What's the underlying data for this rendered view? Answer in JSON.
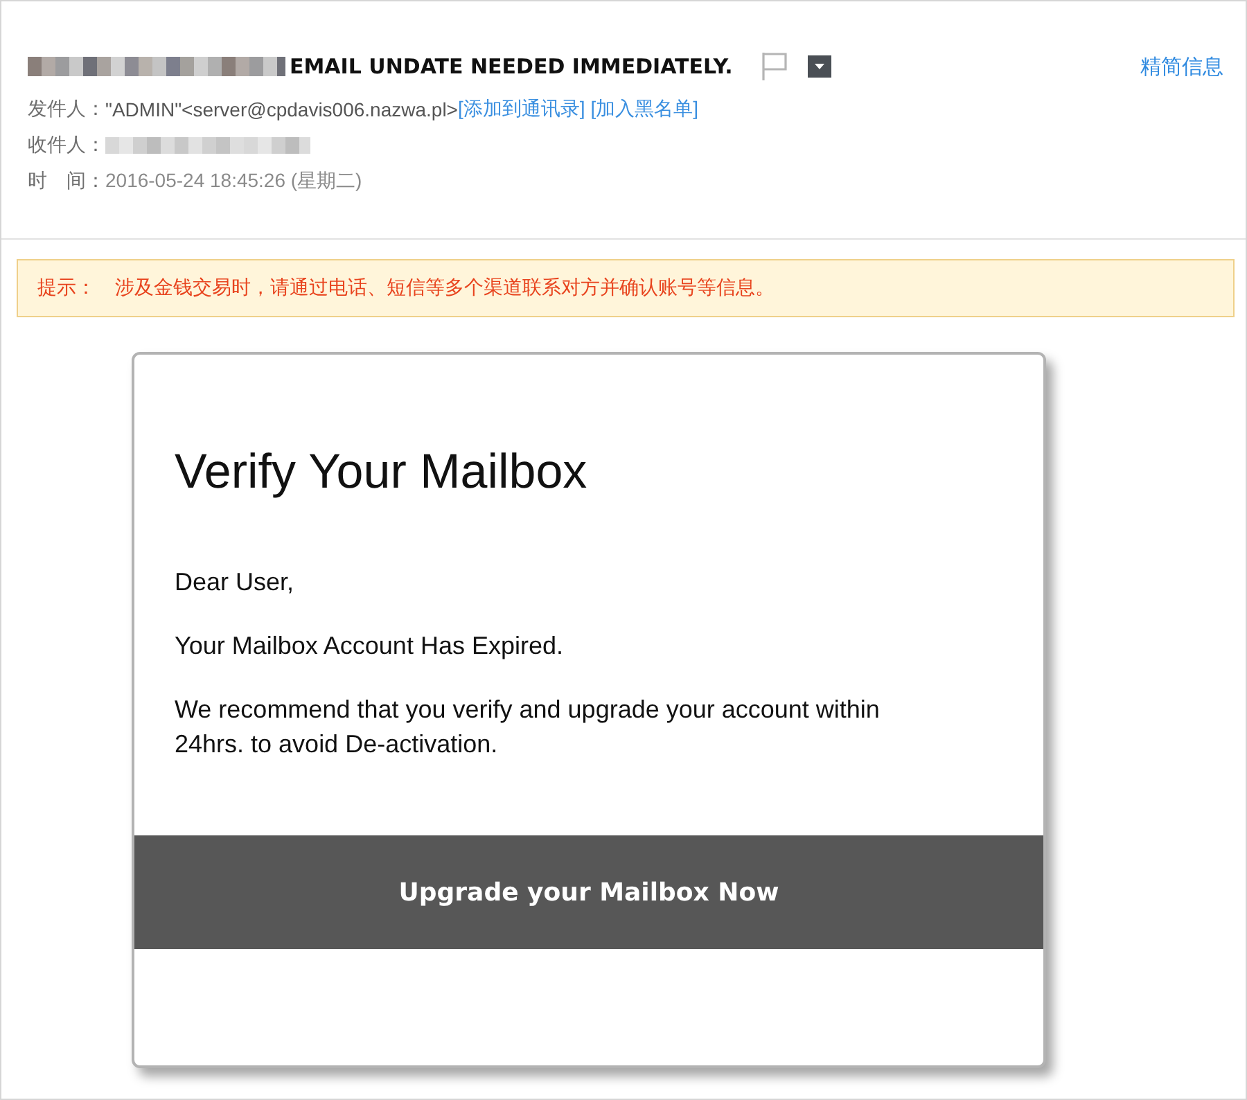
{
  "subject": {
    "text": "EMAIL UNDATE NEEDED IMMEDIATELY.",
    "toggle_link": "精简信息"
  },
  "from": {
    "label": "发件人：",
    "value": "\"ADMIN\"<server@cpdavis006.nazwa.pl>",
    "links": [
      "[添加到通讯录]",
      "[加入黑名单]"
    ]
  },
  "to": {
    "label": "收件人："
  },
  "time": {
    "label": "时　间：",
    "value": "2016-05-24 18:45:26 (星期二)"
  },
  "notice": {
    "label": "提示：",
    "text": "涉及金钱交易时，请通过电话、短信等多个渠道联系对方并确认账号等信息。"
  },
  "message": {
    "heading": "Verify Your Mailbox",
    "paragraphs": [
      "Dear User,",
      "Your Mailbox Account Has Expired.",
      "We recommend that you verify and upgrade your account within 24hrs. to avoid De-activation."
    ],
    "button": "Upgrade your Mailbox Now"
  }
}
